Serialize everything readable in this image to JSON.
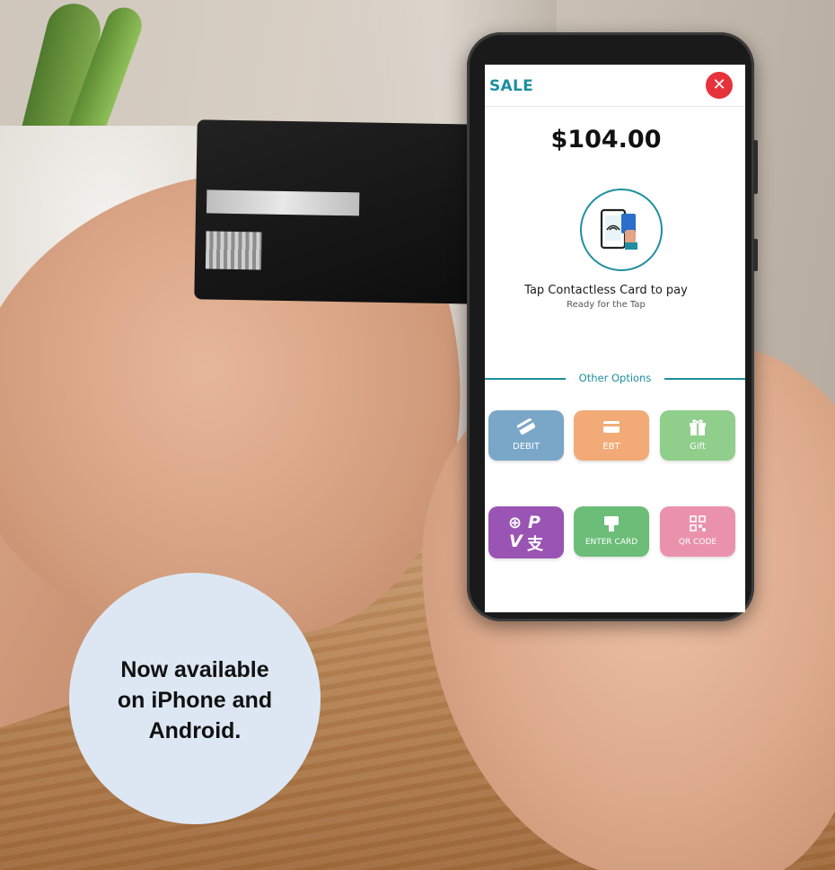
{
  "app": {
    "title": "SALE",
    "close_icon": "close-icon"
  },
  "payment": {
    "amount": "$104.00",
    "prompt": "Tap Contactless Card to pay",
    "status": "Ready for the Tap",
    "icon": "contactless-tap-icon"
  },
  "options": {
    "heading": "Other Options",
    "tiles": [
      {
        "label": "DEBIT",
        "icon": "debit-card-icon",
        "color": "#7aa6c8"
      },
      {
        "label": "EBT",
        "icon": "ebt-card-icon",
        "color": "#f2ab77"
      },
      {
        "label": "Gift",
        "icon": "gift-icon",
        "color": "#8fce8b"
      },
      {
        "label": "",
        "icon": "wallet-payments-icon",
        "color": "#9a55b4"
      },
      {
        "label": "ENTER CARD",
        "icon": "enter-card-icon",
        "color": "#6bbd78"
      },
      {
        "label": "QR CODE",
        "icon": "qr-code-icon",
        "color": "#ea92ac"
      }
    ]
  },
  "promo": {
    "line1": "Now available",
    "line2": "on iPhone and",
    "line3": "Android."
  },
  "colors": {
    "accent": "#1d8fa0",
    "close": "#e5323b",
    "bubble": "#dce7f3"
  }
}
